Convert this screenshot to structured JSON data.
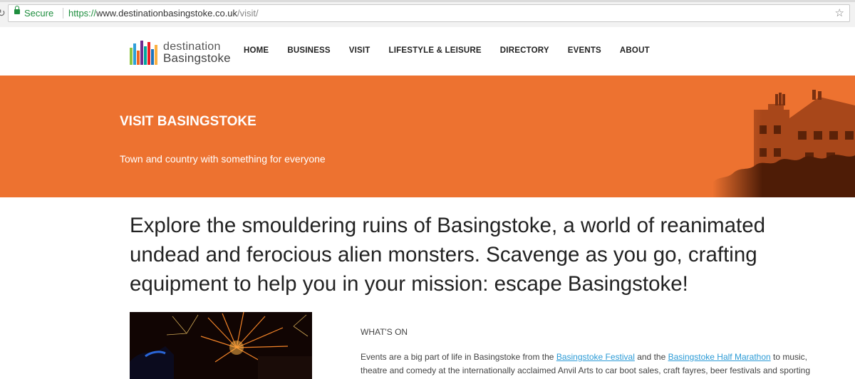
{
  "browser": {
    "secure_label": "Secure",
    "url_scheme": "https://",
    "url_host": "www.destinationbasingstoke.co.uk",
    "url_path": "/visit/",
    "bookmark_icon": "star-icon"
  },
  "logo": {
    "line1": "destination",
    "line2": "Basingstoke",
    "bar_colors": [
      "#8dc63f",
      "#2e9fd9",
      "#f26522",
      "#6f2c91",
      "#00a99d",
      "#ec1c24",
      "#1c75bc",
      "#fbb040"
    ]
  },
  "nav": {
    "items": [
      "HOME",
      "BUSINESS",
      "VISIT",
      "LIFESTYLE & LEISURE",
      "DIRECTORY",
      "EVENTS",
      "ABOUT"
    ]
  },
  "hero": {
    "title": "VISIT BASINGSTOKE",
    "subtitle": "Town and country with something for everyone",
    "color": "#ed7230"
  },
  "main": {
    "lead": "Explore the smouldering ruins of Basingstoke, a world of reanimated undead and ferocious alien monsters. Scavenge as you go, crafting equipment to help you in your mission: escape Basingstoke!",
    "section_label": "WHAT'S ON",
    "body_part1": "Events are a big part of life in Basingstoke from the ",
    "link1": "Basingstoke Festival",
    "body_part2": " and the ",
    "link2": "Basingstoke Half Marathon",
    "body_part3": " to music, theatre and comedy at the internationally acclaimed Anvil Arts to car boot sales, craft fayres, beer festivals and sporting",
    "link_color": "#2c9bd6"
  }
}
